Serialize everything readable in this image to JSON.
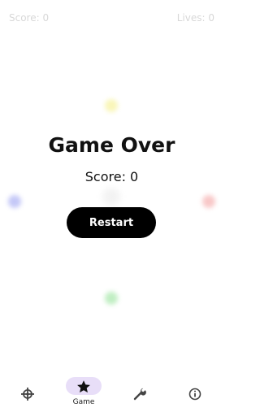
{
  "hud": {
    "score_text": "Score: 0",
    "lives_text": "Lives: 0"
  },
  "game_over": {
    "title": "Game Over",
    "score_text": "Score: 0",
    "restart_label": "Restart"
  },
  "orbs": [
    {
      "name": "yellow-orb",
      "color": "#f5f08a"
    },
    {
      "name": "blue-orb",
      "color": "#9da3f2"
    },
    {
      "name": "red-orb",
      "color": "#f4a3a3"
    },
    {
      "name": "green-orb",
      "color": "#96e39a"
    },
    {
      "name": "center-orb",
      "color": "#dcdcdc"
    }
  ],
  "nav": {
    "items": [
      {
        "icon": "crosshair-icon",
        "label": ""
      },
      {
        "icon": "star-icon",
        "label": "Game",
        "active": true
      },
      {
        "icon": "wrench-icon",
        "label": ""
      },
      {
        "icon": "info-icon",
        "label": ""
      }
    ]
  },
  "colors": {
    "background": "#ffffff",
    "hud_text": "#d8d8d8",
    "primary_text": "#111111",
    "button_bg": "#000000",
    "button_text": "#ffffff",
    "active_nav_bg": "#e8def8",
    "nav_icon": "#444444"
  }
}
